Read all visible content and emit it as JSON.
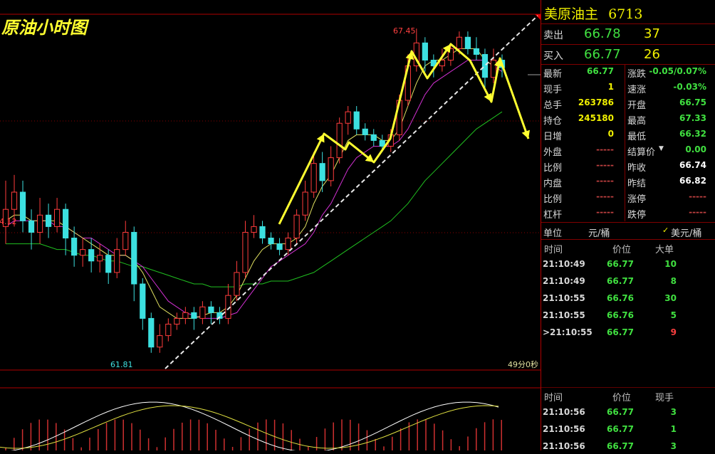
{
  "chart_title": "原油小时图",
  "chart_data": {
    "type": "candlestick",
    "high_label": "67.45",
    "low_label": "61.81",
    "left_label": "64.12",
    "time_label": "49分0秒",
    "ylim": [
      61.5,
      67.7
    ],
    "candles": [
      [
        64.0,
        64.3,
        64.8,
        63.7
      ],
      [
        64.3,
        64.6,
        64.9,
        64.0
      ],
      [
        64.6,
        64.1,
        64.8,
        63.9
      ],
      [
        64.1,
        63.9,
        64.3,
        63.6
      ],
      [
        63.9,
        64.2,
        64.5,
        63.7
      ],
      [
        64.2,
        64.0,
        64.4,
        63.8
      ],
      [
        64.0,
        64.3,
        64.5,
        63.9
      ],
      [
        64.3,
        63.8,
        64.4,
        63.5
      ],
      [
        63.8,
        63.5,
        64.0,
        63.3
      ],
      [
        63.5,
        63.6,
        63.8,
        63.3
      ],
      [
        63.6,
        63.4,
        63.8,
        63.2
      ],
      [
        63.4,
        63.5,
        63.7,
        63.2
      ],
      [
        63.5,
        63.2,
        63.6,
        63.0
      ],
      [
        63.2,
        63.6,
        63.8,
        63.1
      ],
      [
        63.6,
        63.9,
        64.1,
        63.5
      ],
      [
        63.9,
        63.0,
        64.0,
        62.7
      ],
      [
        63.0,
        62.4,
        63.1,
        62.2
      ],
      [
        62.4,
        61.9,
        62.5,
        61.8
      ],
      [
        61.9,
        62.1,
        62.3,
        61.8
      ],
      [
        62.1,
        62.3,
        62.4,
        62.0
      ],
      [
        62.3,
        62.4,
        62.5,
        62.2
      ],
      [
        62.4,
        62.5,
        62.6,
        62.3
      ],
      [
        62.5,
        62.4,
        62.6,
        62.2
      ],
      [
        62.4,
        62.6,
        62.7,
        62.3
      ],
      [
        62.6,
        62.5,
        62.7,
        62.3
      ],
      [
        62.5,
        62.4,
        62.6,
        62.3
      ],
      [
        62.4,
        62.8,
        63.0,
        62.3
      ],
      [
        62.8,
        63.2,
        63.4,
        62.7
      ],
      [
        63.2,
        63.9,
        64.1,
        63.1
      ],
      [
        63.9,
        64.0,
        64.2,
        63.8
      ],
      [
        64.0,
        63.8,
        64.1,
        63.7
      ],
      [
        63.8,
        63.7,
        63.9,
        63.6
      ],
      [
        63.7,
        63.6,
        63.8,
        63.5
      ],
      [
        63.6,
        63.8,
        63.9,
        63.5
      ],
      [
        63.8,
        64.2,
        64.3,
        63.7
      ],
      [
        64.2,
        64.6,
        64.8,
        64.1
      ],
      [
        64.6,
        65.1,
        65.3,
        64.5
      ],
      [
        65.1,
        64.8,
        65.3,
        64.6
      ],
      [
        64.8,
        65.2,
        65.4,
        64.7
      ],
      [
        65.2,
        65.8,
        65.9,
        65.1
      ],
      [
        65.8,
        66.0,
        66.1,
        65.6
      ],
      [
        66.0,
        65.7,
        66.1,
        65.6
      ],
      [
        65.7,
        65.6,
        65.8,
        65.5
      ],
      [
        65.6,
        65.5,
        65.7,
        65.4
      ],
      [
        65.5,
        65.4,
        65.6,
        65.3
      ],
      [
        65.4,
        65.6,
        65.7,
        65.3
      ],
      [
        65.6,
        66.2,
        66.3,
        65.5
      ],
      [
        66.2,
        66.8,
        67.0,
        66.1
      ],
      [
        66.8,
        67.2,
        67.45,
        66.7
      ],
      [
        67.2,
        66.9,
        67.3,
        66.7
      ],
      [
        66.9,
        66.8,
        67.0,
        66.6
      ],
      [
        66.8,
        66.9,
        67.1,
        66.7
      ],
      [
        66.9,
        67.1,
        67.2,
        66.8
      ],
      [
        67.1,
        67.3,
        67.4,
        67.0
      ],
      [
        67.3,
        67.1,
        67.4,
        67.0
      ],
      [
        67.1,
        67.0,
        67.3,
        66.9
      ],
      [
        67.0,
        66.6,
        67.1,
        66.4
      ],
      [
        66.6,
        66.9,
        67.1,
        66.5
      ],
      [
        66.9,
        66.77,
        67.0,
        66.6
      ]
    ],
    "ma_short": [
      64.1,
      64.2,
      64.2,
      64.1,
      64.1,
      64.1,
      64.1,
      64.0,
      63.9,
      63.8,
      63.7,
      63.6,
      63.5,
      63.5,
      63.5,
      63.4,
      63.2,
      62.9,
      62.6,
      62.5,
      62.4,
      62.4,
      62.4,
      62.45,
      62.5,
      62.5,
      62.6,
      62.8,
      63.1,
      63.4,
      63.6,
      63.7,
      63.7,
      63.7,
      63.8,
      64.0,
      64.4,
      64.7,
      64.9,
      65.2,
      65.5,
      65.6,
      65.6,
      65.6,
      65.5,
      65.5,
      65.7,
      66.1,
      66.5,
      66.8,
      66.9,
      66.9,
      67.0,
      67.1,
      67.1,
      67.1,
      66.9,
      66.8,
      66.8
    ],
    "ma_mid": [
      64.0,
      64.1,
      64.1,
      64.1,
      64.1,
      64.1,
      64.0,
      64.0,
      63.9,
      63.8,
      63.8,
      63.7,
      63.6,
      63.5,
      63.5,
      63.4,
      63.3,
      63.1,
      62.9,
      62.7,
      62.6,
      62.5,
      62.45,
      62.4,
      62.4,
      62.4,
      62.45,
      62.5,
      62.7,
      62.9,
      63.1,
      63.3,
      63.4,
      63.5,
      63.6,
      63.7,
      63.9,
      64.2,
      64.4,
      64.7,
      65.0,
      65.2,
      65.3,
      65.4,
      65.4,
      65.4,
      65.5,
      65.7,
      66.0,
      66.3,
      66.5,
      66.6,
      66.7,
      66.8,
      66.9,
      66.9,
      66.9,
      66.8,
      66.7
    ],
    "ma_long": [
      63.7,
      63.7,
      63.7,
      63.7,
      63.7,
      63.65,
      63.6,
      63.6,
      63.55,
      63.5,
      63.5,
      63.45,
      63.4,
      63.4,
      63.35,
      63.3,
      63.3,
      63.25,
      63.2,
      63.15,
      63.1,
      63.05,
      63.0,
      63.0,
      62.95,
      62.95,
      62.95,
      62.95,
      63.0,
      63.0,
      63.0,
      63.05,
      63.05,
      63.05,
      63.1,
      63.15,
      63.2,
      63.3,
      63.4,
      63.5,
      63.6,
      63.7,
      63.8,
      63.9,
      64.0,
      64.1,
      64.25,
      64.4,
      64.6,
      64.8,
      64.95,
      65.1,
      65.25,
      65.4,
      65.55,
      65.7,
      65.8,
      65.9,
      66.0
    ]
  },
  "panel": {
    "title": "美原油主",
    "title_code": "6713",
    "ask_label": "卖出",
    "ask_price": "66.78",
    "ask_vol": "37",
    "bid_label": "买入",
    "bid_price": "66.77",
    "bid_vol": "26",
    "quote_rows": [
      {
        "l1": "最新",
        "v1": "66.77",
        "c1": "green",
        "l2": "涨跌",
        "v2": "-0.05/0.07%",
        "c2": "green"
      },
      {
        "l1": "现手",
        "v1": "1",
        "c1": "yellow",
        "l2": "速涨",
        "v2": "-0.03%",
        "c2": "green"
      },
      {
        "l1": "总手",
        "v1": "263786",
        "c1": "yellow",
        "l2": "开盘",
        "v2": "66.75",
        "c2": "green"
      },
      {
        "l1": "持仓",
        "v1": "245180",
        "c1": "yellow",
        "l2": "最高",
        "v2": "67.33",
        "c2": "green"
      },
      {
        "l1": "日增",
        "v1": "0",
        "c1": "yellow",
        "l2": "最低",
        "v2": "66.32",
        "c2": "green"
      },
      {
        "l1": "外盘",
        "v1": "-----",
        "c1": "dash",
        "l2": "结算价",
        "v2": "0.00",
        "c2": "green"
      },
      {
        "l1": "比例",
        "v1": "-----",
        "c1": "dash",
        "l2": "昨收",
        "v2": "66.74",
        "c2": "white"
      },
      {
        "l1": "内盘",
        "v1": "-----",
        "c1": "dash",
        "l2": "昨结",
        "v2": "66.82",
        "c2": "white"
      },
      {
        "l1": "比例",
        "v1": "-----",
        "c1": "dash",
        "l2": "涨停",
        "v2": "-----",
        "c2": "dash"
      },
      {
        "l1": "杠杆",
        "v1": "-----",
        "c1": "dash",
        "l2": "跌停",
        "v2": "-----",
        "c2": "dash"
      }
    ],
    "unit_label": "单位",
    "unit_value": "元/桶",
    "unit_check": "✓",
    "unit_alt": "美元/桶",
    "trades1_headers": [
      "时间",
      "价位",
      "大单"
    ],
    "trades1": [
      {
        "t": "21:10:49",
        "p": "66.77",
        "v": "10",
        "c": "green"
      },
      {
        "t": "21:10:49",
        "p": "66.77",
        "v": "8",
        "c": "green"
      },
      {
        "t": "21:10:55",
        "p": "66.76",
        "v": "30",
        "c": "green"
      },
      {
        "t": "21:10:55",
        "p": "66.76",
        "v": "5",
        "c": "green"
      },
      {
        "t": ">21:10:55",
        "p": "66.77",
        "v": "9",
        "c": "red"
      }
    ],
    "trades2_headers": [
      "时间",
      "价位",
      "现手"
    ],
    "trades2": [
      {
        "t": "21:10:56",
        "p": "66.77",
        "v": "3",
        "c": "green"
      },
      {
        "t": "21:10:56",
        "p": "66.77",
        "v": "1",
        "c": "green"
      },
      {
        "t": "21:10:56",
        "p": "66.77",
        "v": "3",
        "c": "green"
      }
    ]
  }
}
